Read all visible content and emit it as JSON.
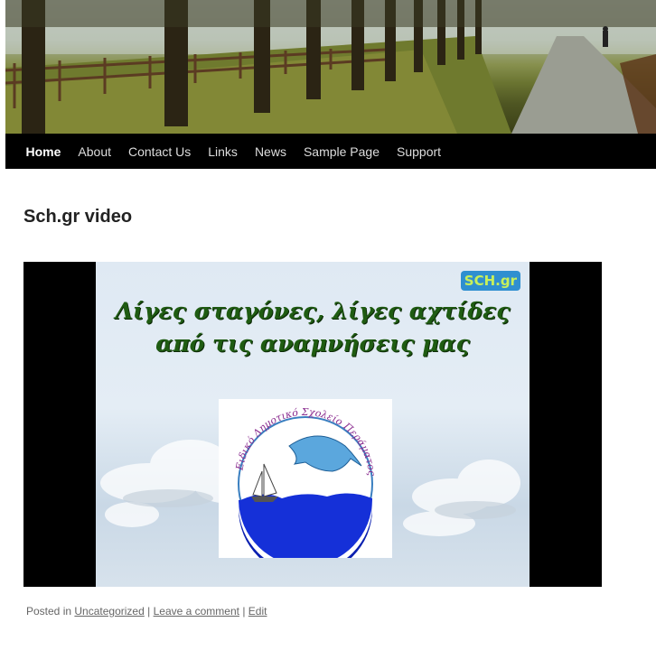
{
  "nav": {
    "items": [
      {
        "label": "Home",
        "active": true
      },
      {
        "label": "About"
      },
      {
        "label": "Contact Us"
      },
      {
        "label": "Links"
      },
      {
        "label": "News"
      },
      {
        "label": "Sample Page"
      },
      {
        "label": "Support"
      }
    ]
  },
  "post": {
    "title": "Sch.gr video"
  },
  "video": {
    "badge": "SCH.gr",
    "caption_line1": "Λίγες σταγόνες, λίγες αχτίδες",
    "caption_line2": "από τις αναμνήσεις μας",
    "logo_text": "Ειδικό Δημοτικό Σχολείο Περάματος"
  },
  "meta": {
    "posted_in": "Posted in",
    "category": "Uncategorized",
    "sep1": "|",
    "comment": "Leave a comment",
    "sep2": "|",
    "edit": "Edit"
  }
}
